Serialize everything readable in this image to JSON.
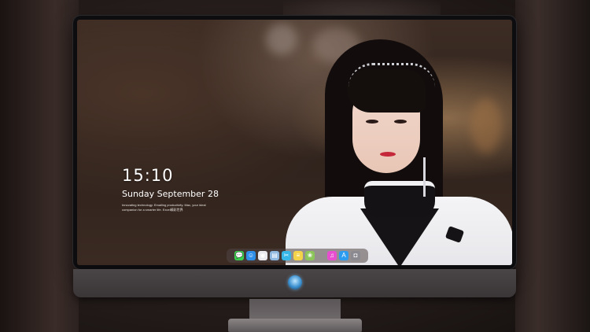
{
  "lockscreen": {
    "time": "15:10",
    "date": "Sunday September 28",
    "tagline": "Innovating technology. Emailing productivity. Mac, your ideal companion for a smarter life. Excel精彩世界"
  },
  "dock": {
    "icons": [
      {
        "name": "messages-icon",
        "glyph": "💬",
        "color": "#3ccf4e"
      },
      {
        "name": "finder-icon",
        "glyph": "☺",
        "color": "#2f8ee8"
      },
      {
        "name": "safari-icon",
        "glyph": "◉",
        "color": "#e9e9ee"
      },
      {
        "name": "preview-icon",
        "glyph": "▤",
        "color": "#8fb8e0"
      },
      {
        "name": "finalcut-icon",
        "glyph": "✂",
        "color": "#36b7e8"
      },
      {
        "name": "notes-icon",
        "glyph": "≡",
        "color": "#f5d348"
      },
      {
        "name": "photos-icon",
        "glyph": "❀",
        "color": "#8cc65a"
      },
      {
        "name": "music-icon",
        "glyph": "♫",
        "color": "#e84fd0"
      },
      {
        "name": "appstore-icon",
        "glyph": "A",
        "color": "#2b9cf0"
      },
      {
        "name": "camera-icon",
        "glyph": "◘",
        "color": "#8a8a90"
      }
    ]
  },
  "colors": {
    "accent_logo": "#3a8fcf",
    "lips": "#c4283a"
  }
}
